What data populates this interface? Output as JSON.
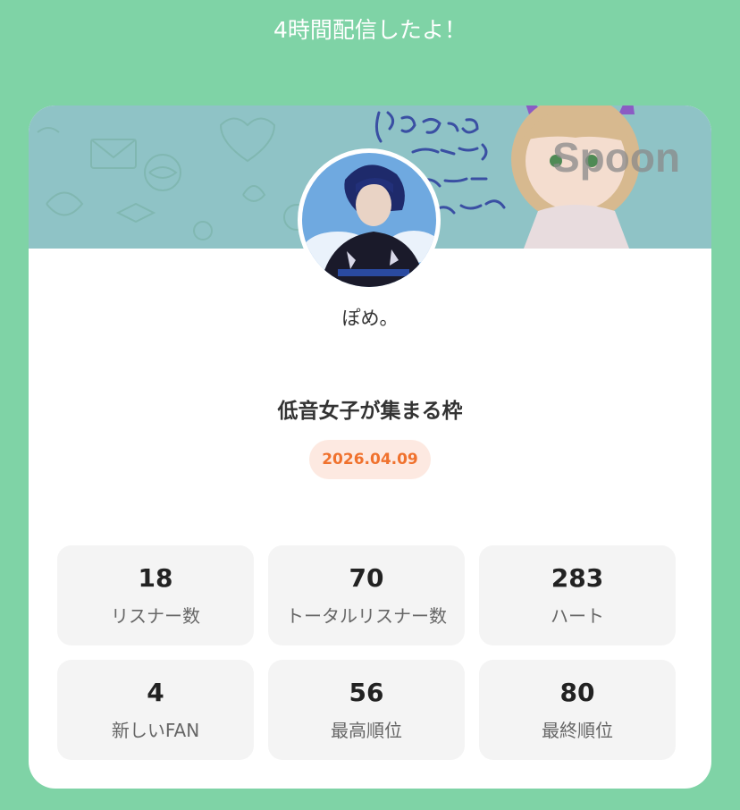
{
  "header": {
    "title": "4時間配信したよ！"
  },
  "banner": {
    "brand": "Spoon"
  },
  "profile": {
    "name": "ぽめ。"
  },
  "broadcast": {
    "title": "低音女子が集まる枠",
    "date": "2026.04.09"
  },
  "stats": [
    {
      "value": "18",
      "label": "リスナー数"
    },
    {
      "value": "70",
      "label": "トータルリスナー数"
    },
    {
      "value": "283",
      "label": "ハート"
    },
    {
      "value": "4",
      "label": "新しいFAN"
    },
    {
      "value": "56",
      "label": "最高順位"
    },
    {
      "value": "80",
      "label": "最終順位"
    }
  ],
  "colors": {
    "background": "#7fd3a6",
    "card": "#ffffff",
    "date_text": "#f0722e",
    "date_pill": "#fde9e1",
    "stat_box": "#f4f4f4"
  }
}
